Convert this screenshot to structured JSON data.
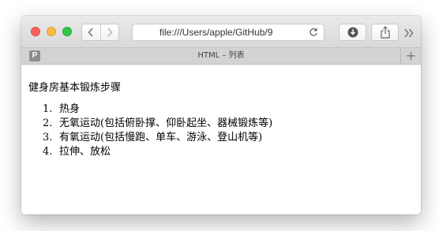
{
  "browser": {
    "address": "file:///Users/apple/GitHub/9",
    "tab_title": "HTML – 列表",
    "favicon_letter": "P",
    "new_tab": "+",
    "icons": [
      "close-traffic-light",
      "minimize-traffic-light",
      "maximize-traffic-light",
      "back-icon",
      "forward-icon",
      "reload-icon",
      "download-icon",
      "share-icon",
      "more-icon",
      "plus-icon"
    ]
  },
  "page": {
    "heading": "健身房基本锻炼步骤",
    "steps": [
      {
        "num": "1.",
        "text": "热身"
      },
      {
        "num": "2.",
        "text": "无氧运动(包括俯卧撑、仰卧起坐、器械锻炼等)"
      },
      {
        "num": "3.",
        "text": "有氧运动(包括慢跑、单车、游泳、登山机等)"
      },
      {
        "num": "4.",
        "text": "拉伸、放松"
      }
    ]
  },
  "colors": {
    "close": "#fc605c",
    "minimize": "#fdbc40",
    "maximize": "#34c84a",
    "toolbar": "#e2e2e2",
    "tabbar": "#d3d3d3"
  }
}
